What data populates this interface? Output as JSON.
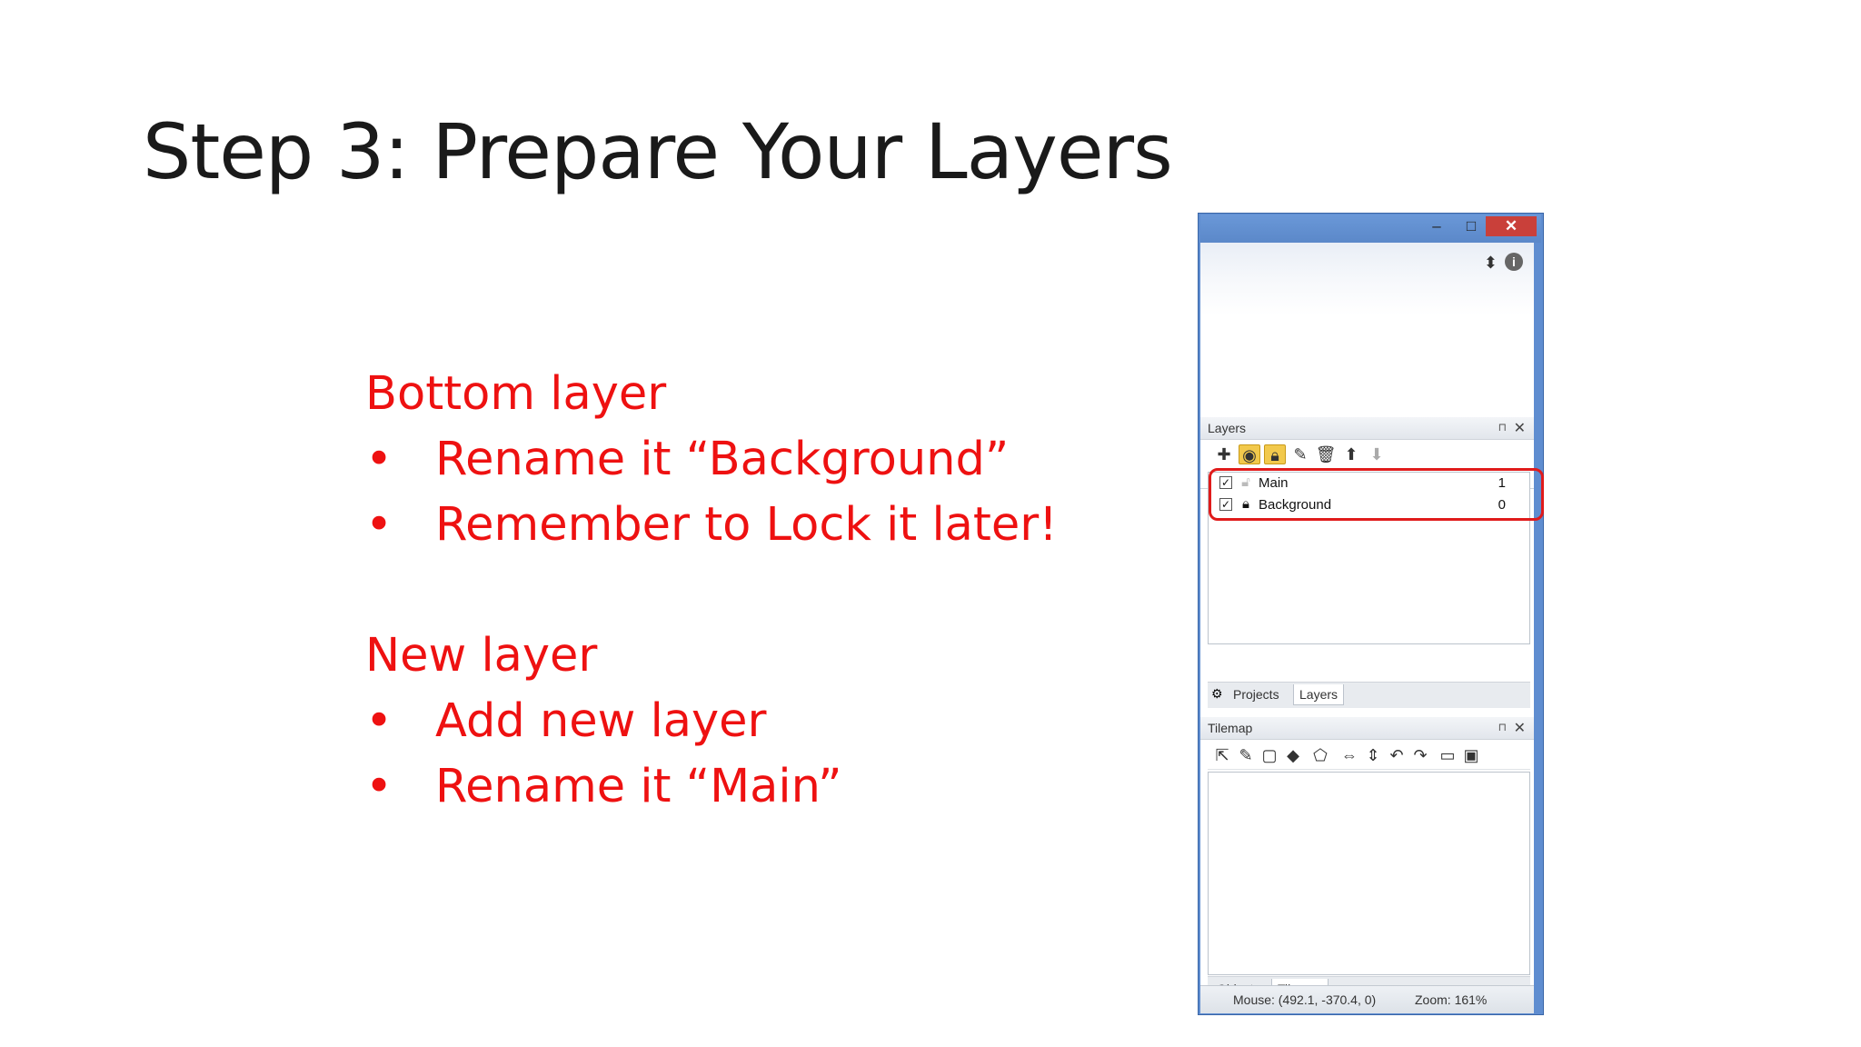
{
  "slide": {
    "title": "Step 3: Prepare Your Layers",
    "sections": [
      {
        "heading": "Bottom layer",
        "bullets": [
          "Rename it “Background”",
          "Remember to Lock it later!"
        ]
      },
      {
        "heading": "New layer",
        "bullets": [
          "Add new layer",
          "Rename it “Main”"
        ]
      }
    ],
    "bullet_glyph": "•"
  },
  "window": {
    "minimize": "–",
    "maximize": "□",
    "close": "✕"
  },
  "layers_panel": {
    "title": "Layers",
    "pin": "⊓",
    "close": "✕",
    "tools": [
      "add-icon",
      "eye-icon",
      "lock-icon",
      "pencil-icon",
      "trash-icon",
      "arrow-up-icon",
      "arrow-down-icon"
    ],
    "rows": [
      {
        "name": "Main",
        "number": "1",
        "checked": true,
        "locked": false
      },
      {
        "name": "Background",
        "number": "0",
        "checked": true,
        "locked": true
      }
    ],
    "tabs": [
      "Projects",
      "Layers"
    ],
    "selected_tab": "Layers"
  },
  "tilemap_panel": {
    "title": "Tilemap",
    "pin": "⊓",
    "close": "✕",
    "tabs": [
      "Objects",
      "Tilemap"
    ],
    "selected_tab": "Tilemap"
  },
  "status": {
    "mouse": "Mouse: (492.1, -370.4, 0)",
    "zoom": "Zoom: 161%"
  },
  "colors": {
    "accent_text": "#ee1111",
    "highlight": "#e01b1b",
    "title_bar": "#5f8dd0"
  }
}
